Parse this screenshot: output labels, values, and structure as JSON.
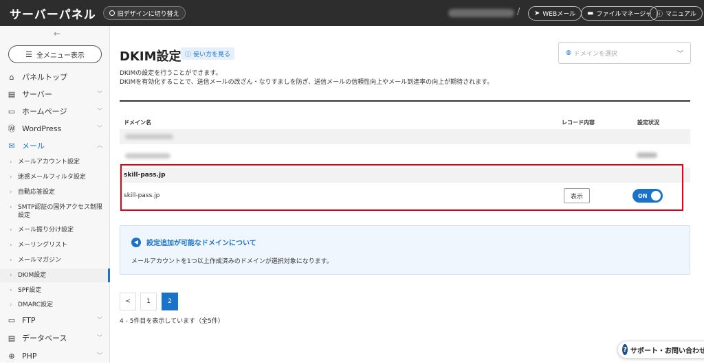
{
  "header": {
    "brand": "サーバーパネル",
    "old_design": "旧デザインに切り替え",
    "webmail": "WEBメール",
    "file_manager": "ファイルマネージャ",
    "manual": "マニュアル"
  },
  "sidebar": {
    "all_menu": "全メニュー表示",
    "items": {
      "panel_top": "パネルトップ",
      "server": "サーバー",
      "homepage": "ホームページ",
      "wordpress": "WordPress",
      "mail": "メール",
      "ftp": "FTP",
      "database": "データベース",
      "php": "PHP"
    },
    "mail_sub": [
      "メールアカウント設定",
      "迷惑メールフィルタ設定",
      "自動応答設定",
      "SMTP認証の国外アクセス制限設定",
      "メール振り分け設定",
      "メーリングリスト",
      "メールマガジン",
      "DKIM設定",
      "SPF設定",
      "DMARC設定"
    ]
  },
  "main": {
    "title": "DKIM設定",
    "help": "使い方を見る",
    "domain_select_placeholder": "ドメインを選択",
    "desc1": "DKIMの設定を行うことができます。",
    "desc2": "DKIMを有効化することで、送信メールの改ざん・なりすましを防ぎ、送信メールの信頼性向上やメール到達率の向上が期待されます。",
    "col_domain": "ドメイン名",
    "col_record": "レコード内容",
    "col_status": "設定状況",
    "group_domain": "skill-pass.jp",
    "row_domain": "skill-pass.jp",
    "show_button": "表示",
    "toggle_label": "ON",
    "info_title": "設定追加が可能なドメインについて",
    "info_body": "メールアカウントを1つ以上作成済みのドメインが選択対象になります。",
    "pager": {
      "prev": "<",
      "p1": "1",
      "p2": "2"
    },
    "count": "4 - 5件目を表示しています（全5件）"
  },
  "support": "サポート・お問い合わせ",
  "colors": {
    "accent": "#1a73c8",
    "highlight": "#e0001b",
    "topbar": "#2d2d2d"
  }
}
